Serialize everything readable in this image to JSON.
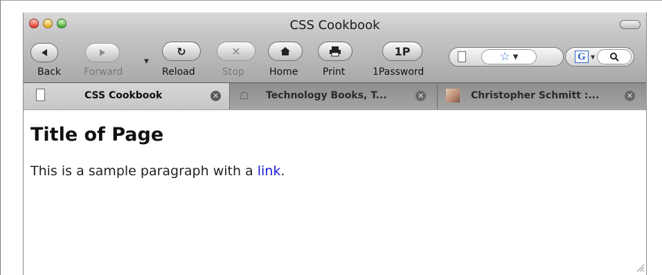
{
  "window": {
    "title": "CSS Cookbook"
  },
  "toolbar": {
    "back": "Back",
    "forward": "Forward",
    "reload": "Reload",
    "stop": "Stop",
    "home": "Home",
    "print": "Print",
    "onepassword": "1Password",
    "onepassword_button": "1P",
    "icons": {
      "back": "back-arrow-icon",
      "forward": "forward-arrow-icon",
      "reload": "reload-icon",
      "stop": "stop-icon",
      "home": "home-icon",
      "print": "print-icon",
      "bookmark": "bookmark-star-icon",
      "search": "magnifier-icon",
      "search_engine": "google-icon"
    },
    "search_engine_label": "G"
  },
  "tabs": [
    {
      "title": "CSS Cookbook",
      "active": true,
      "icon": "document-icon"
    },
    {
      "title": "Technology Books, T...",
      "active": false,
      "icon": "gamepad-icon"
    },
    {
      "title": "Christopher Schmitt :...",
      "active": false,
      "icon": "photo-favicon"
    }
  ],
  "page": {
    "heading": "Title of Page",
    "paragraph_before": "This is a sample paragraph with a ",
    "link_text": "link",
    "paragraph_after": "."
  }
}
